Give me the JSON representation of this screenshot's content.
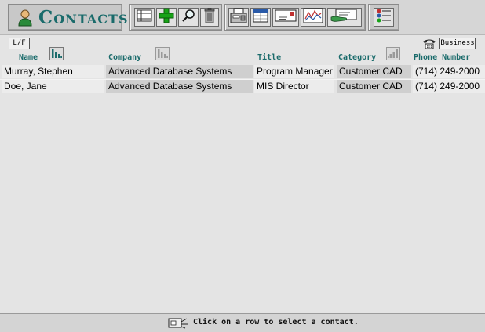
{
  "app": {
    "title": "Contacts"
  },
  "toolbar": {
    "buttons": [
      {
        "icon": "list-view-icon"
      },
      {
        "icon": "add-plus-icon"
      },
      {
        "icon": "magnifier-icon"
      },
      {
        "icon": "trash-icon"
      },
      {
        "icon": "fax-icon"
      },
      {
        "icon": "calendar-icon"
      },
      {
        "icon": "envelope-icon"
      },
      {
        "icon": "report-chart-icon"
      },
      {
        "icon": "card-hand-icon"
      },
      {
        "icon": "checklist-icon"
      }
    ]
  },
  "name_format_button": "L/F",
  "phone_type_button": "Business",
  "columns": {
    "name": "Name",
    "company": "Company",
    "title": "Title",
    "category": "Category",
    "phone": "Phone Number"
  },
  "rows": [
    {
      "name": "Murray, Stephen",
      "company": "Advanced Database Systems",
      "title": "Program Manager",
      "category": "Customer CAD",
      "phone": "(714) 249-2000"
    },
    {
      "name": "Doe, Jane",
      "company": "Advanced Database Systems",
      "title": "MIS Director",
      "category": "Customer CAD",
      "phone": "(714) 249-2000"
    }
  ],
  "status": {
    "message": "Click on a row to select a contact."
  },
  "colors": {
    "accent": "#1a6b6b",
    "background": "#e4e4e4",
    "add_green": "#17a317"
  }
}
